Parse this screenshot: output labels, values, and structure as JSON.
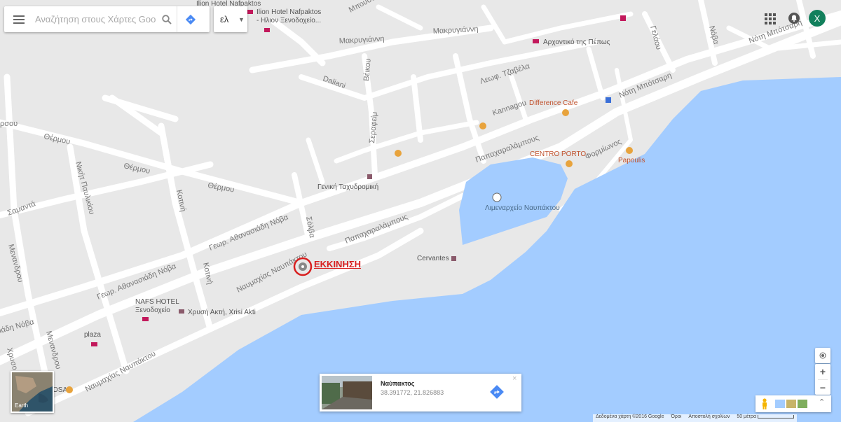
{
  "search": {
    "placeholder": "Αναζήτηση στους Χάρτες Google"
  },
  "language": {
    "value": "ελ"
  },
  "account": {
    "initial": "X",
    "color": "#12805c"
  },
  "icons": {
    "menu": "hamburger-menu-icon",
    "search": "search-icon",
    "directions": "directions-icon",
    "apps": "apps-grid-icon",
    "notifications": "notifications-icon",
    "locate": "my-location-icon",
    "pegman": "pegman-icon",
    "expand": "chevron-up-icon"
  },
  "map": {
    "streets": [
      "Μπουσάρ…",
      "Μακρυγιάννη",
      "Μακρυγιάννη",
      "Βέικου",
      "Daliani",
      "Λεωφ. Τζαβέλα",
      "Γελάου",
      "Νόβα",
      "Νότη Μπότσαρη",
      "Νότη Μπότσαρη",
      "Kannagou",
      "Σεραφείμ",
      "Παπαχαραλάμπους",
      "Παπαχαραλάμπους",
      "Φορμίωνος",
      "Θέρμου",
      "Θέρμου",
      "Θέρμου",
      "Νικήτ Παυλικίου",
      "Κοτινή",
      "Κοτινή",
      "Σαμαντά",
      "Γεωρ. Αθανασιάδη Νόβα",
      "Γεωρ. Αθανασιάδη Νόβα",
      "Σόλβα",
      "Ναυμαχίας Ναυπάκτου",
      "Μενανδρου",
      "Μενανδρου",
      "Ναυμαχίας Ναυπάκτου",
      "ιάδη Νόβα",
      "Χρυσο",
      "ρσου"
    ],
    "pois": {
      "hotel_top": [
        "Ilion Hotel Nafpaktos",
        "- Ηλιον Ξενοδοχείο..."
      ],
      "hotel_top_cut": "Ilion Hotel Nafpaktos",
      "arxontiko": "Αρχοντικό της Πέπως",
      "difference_cafe": "Difference Cafe",
      "centro_porto": "CENTRO PORTO",
      "papoulis": "Papoulis",
      "post_office": "Γενική Ταχυδρομική",
      "port_authority": "Λιμεναρχείο Ναυπάκτου",
      "cervantes": "Cervantes",
      "nafs_hotel": [
        "NAFS HOTEL",
        "Ξενοδοχείο"
      ],
      "chrysi_akti": "Χρυσή Ακτή, Xrisi Akti",
      "plaza": "plaza",
      "osa": "OSA"
    },
    "colors": {
      "water": "#a3ccff",
      "land": "#e8e8e8",
      "road": "#ffffff",
      "hotel": "#c2185b",
      "food": "#e8a33c"
    }
  },
  "start_marker": {
    "label": "ΕΚΚΙΝΗΣΗ",
    "color": "#d81f1f"
  },
  "earth": {
    "label": "Earth"
  },
  "card": {
    "title": "Ναύπακτος",
    "coords": "38.391772, 21.826883",
    "close": "×"
  },
  "zoom": {
    "in": "+",
    "out": "−"
  },
  "footer": {
    "data": "Δεδομένα χάρτη ©2016 Google",
    "terms": "Όροι",
    "feedback": "Αποστολή σχολίων",
    "scale": "50 μέτρα"
  }
}
